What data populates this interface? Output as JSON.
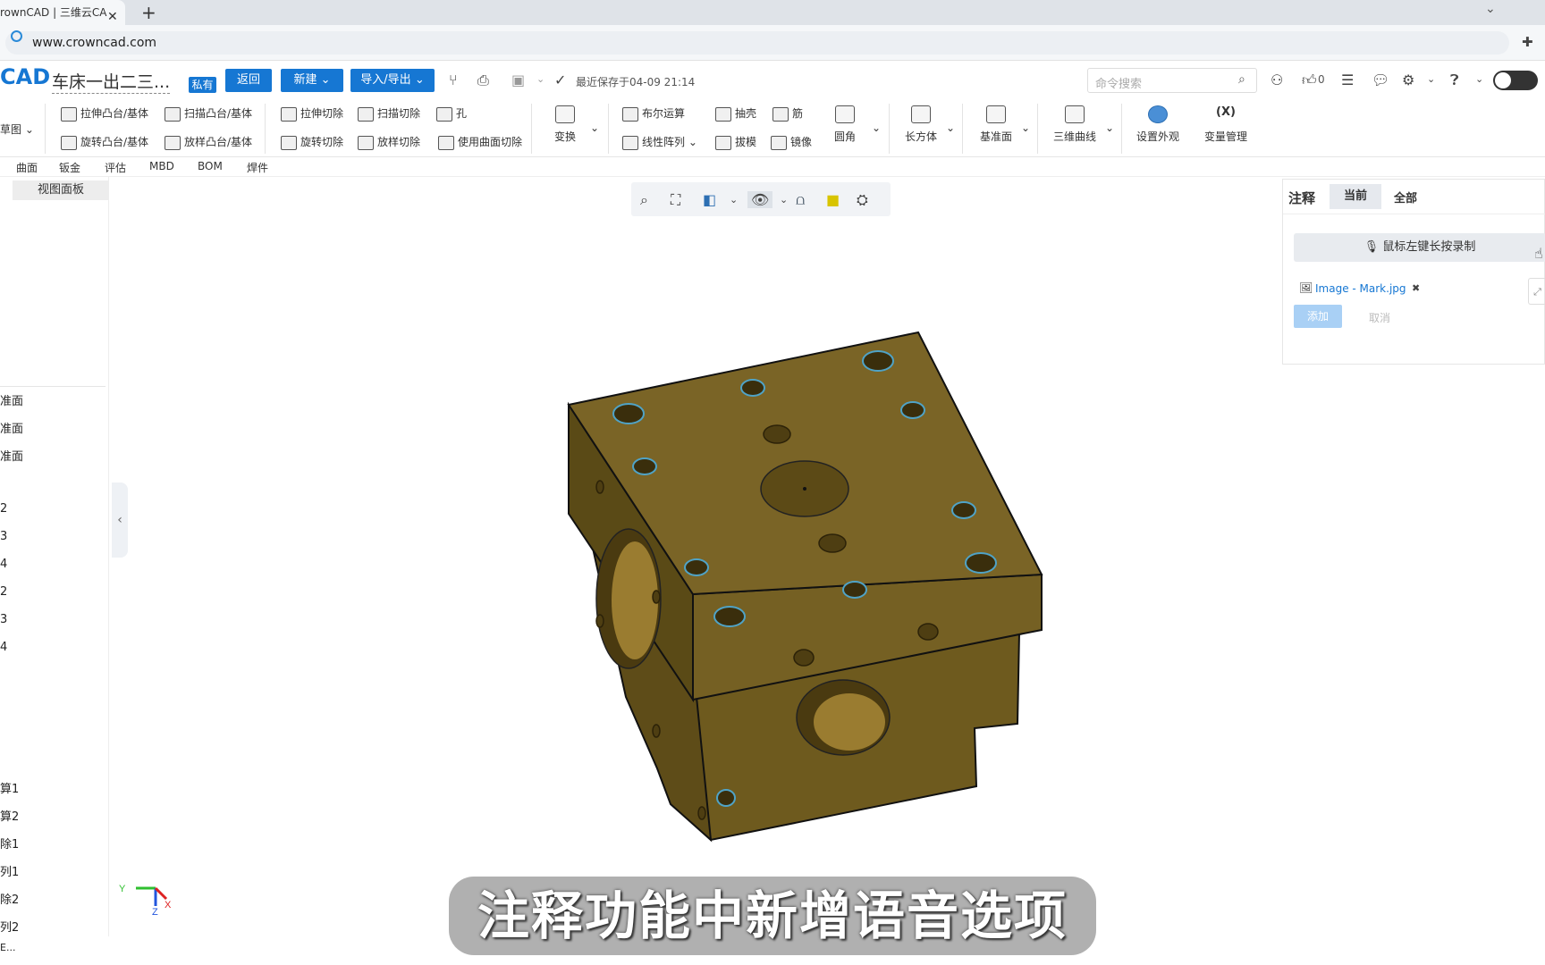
{
  "browser": {
    "tab_title": "rownCAD | 三维云CA",
    "tab_close": "✕",
    "new_tab": "+",
    "url": "www.crowncad.com"
  },
  "header": {
    "logo": "CAD",
    "doc_title": "车床一出二三...",
    "private_badge": "私有",
    "back": "返回",
    "new": "新建",
    "import_export": "导入/导出",
    "last_saved": "最近保存于04-09 21:14",
    "search_placeholder": "命令搜索",
    "like_count": "0"
  },
  "ribbon": {
    "sketch": "草图",
    "extrude_boss": "拉伸凸台/基体",
    "sweep_boss": "扫描凸台/基体",
    "revolve_boss": "旋转凸台/基体",
    "loft_boss": "放样凸台/基体",
    "extrude_cut": "拉伸切除",
    "sweep_cut": "扫描切除",
    "hole": "孔",
    "revolve_cut": "旋转切除",
    "loft_cut": "放样切除",
    "surface_cut": "使用曲面切除",
    "transform": "变换",
    "boolean": "布尔运算",
    "shell": "抽壳",
    "rib": "筋",
    "linear_pattern": "线性阵列",
    "draft": "拔模",
    "mirror": "镜像",
    "fillet": "圆角",
    "box": "长方体",
    "datum_plane": "基准面",
    "curve3d": "三维曲线",
    "appearance": "设置外观",
    "var_icon": "(X)",
    "variables": "变量管理"
  },
  "subtabs": [
    "曲面",
    "钣金",
    "评估",
    "MBD",
    "BOM",
    "焊件"
  ],
  "left_panel": {
    "view_panel": "视图面板",
    "tree": [
      "准面",
      "准面",
      "准面",
      "2",
      "3",
      "4",
      "2",
      "3",
      "4",
      "算1",
      "算2",
      "除1",
      "列1",
      "除2",
      "列2",
      "E..."
    ]
  },
  "annotation": {
    "title": "注释",
    "tab_current": "当前",
    "tab_all": "全部",
    "record": "鼠标左键长按录制",
    "attachment": "Image - Mark.jpg",
    "remove": "✖",
    "add": "添加",
    "cancel": "取消"
  },
  "axes": {
    "y": "Y",
    "z": "Z",
    "x": "X"
  },
  "subtitle": "注释功能中新增语音选项",
  "colors": {
    "accent": "#1677d3",
    "part": "#7a6426",
    "hole_edge": "#4fa3c7"
  }
}
